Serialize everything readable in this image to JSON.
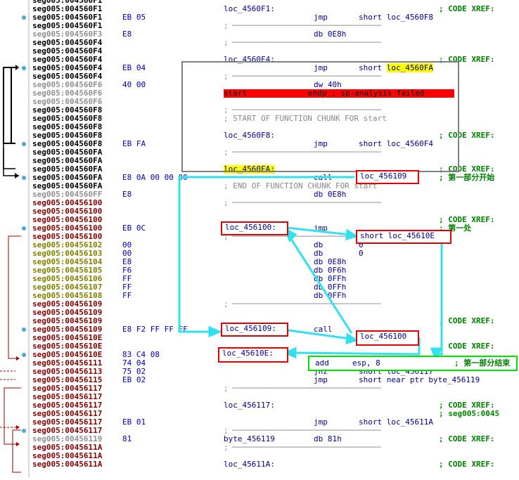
{
  "rows": [
    {
      "addr": "seg005:004560F1",
      "ac": "a-black",
      "bytes": "",
      "label": "",
      "mn": "",
      "op": "",
      "cm": ""
    },
    {
      "addr": "seg005:004560F1",
      "ac": "a-black",
      "bytes": "",
      "label": "loc_4560F1:",
      "mn": "",
      "op": "",
      "cm": "; CODE XREF:"
    },
    {
      "addr": "seg005:004560F1",
      "ac": "a-black",
      "bytes": "EB 05",
      "label": "",
      "mn": "jmp",
      "op": "short loc_4560F8",
      "cm": ""
    },
    {
      "addr": "seg005:004560F1",
      "ac": "a-black",
      "bytes": "",
      "label": ";",
      "mn": "",
      "op": "",
      "cm": "",
      "sep": true
    },
    {
      "addr": "seg005:004560F3",
      "ac": "a-gray",
      "bytes": "E8",
      "label": "",
      "mn": "db 0E8h",
      "op": "",
      "cm": ""
    },
    {
      "addr": "seg005:004560F4",
      "ac": "a-black",
      "bytes": "",
      "label": ";",
      "mn": "",
      "op": "",
      "cm": "",
      "sep": true
    },
    {
      "addr": "seg005:004560F4",
      "ac": "a-black",
      "bytes": "",
      "label": "",
      "mn": "",
      "op": "",
      "cm": ""
    },
    {
      "addr": "seg005:004560F4",
      "ac": "a-black",
      "bytes": "",
      "label": "loc_4560F4:",
      "mn": "",
      "op": "",
      "cm": "; CODE XREF:"
    },
    {
      "addr": "seg005:004560F4",
      "ac": "a-black",
      "bytes": "EB 04",
      "label": "",
      "mn": "jmp",
      "op": "short loc_4560FA",
      "cm": "",
      "ophl": "yellow"
    },
    {
      "addr": "seg005:004560F4",
      "ac": "a-black",
      "bytes": "",
      "label": ";",
      "mn": "",
      "op": "",
      "cm": "",
      "sep": true
    },
    {
      "addr": "seg005:004560F6",
      "ac": "a-gray",
      "bytes": "40 00",
      "label": "",
      "mn": "dw 40h",
      "op": "",
      "cm": ""
    },
    {
      "addr": "seg005:004560F6",
      "ac": "a-gray",
      "bytes": "",
      "label": "start",
      "mn": "endp ; sp-analysis failed",
      "op": "",
      "cm": "",
      "rowhl": "red"
    },
    {
      "addr": "seg005:004560F6",
      "ac": "a-gray",
      "bytes": "",
      "label": "",
      "mn": "",
      "op": "",
      "cm": ""
    },
    {
      "addr": "seg005:004560F8",
      "ac": "a-black",
      "bytes": "",
      "label": ";",
      "mn": "",
      "op": "",
      "cm": "",
      "sep": true
    },
    {
      "addr": "seg005:004560F8",
      "ac": "a-black",
      "bytes": "",
      "label": "; START OF FUNCTION CHUNK FOR start",
      "mn": "",
      "op": "",
      "cm": "",
      "gray": true
    },
    {
      "addr": "seg005:004560F8",
      "ac": "a-black",
      "bytes": "",
      "label": "",
      "mn": "",
      "op": "",
      "cm": ""
    },
    {
      "addr": "seg005:004560F8",
      "ac": "a-black",
      "bytes": "",
      "label": "loc_4560F8:",
      "mn": "",
      "op": "",
      "cm": "; CODE XREF:"
    },
    {
      "addr": "seg005:004560F8",
      "ac": "a-black",
      "bytes": "EB FA",
      "label": "",
      "mn": "jmp",
      "op": "short loc_4560F4",
      "cm": ""
    },
    {
      "addr": "seg005:004560FA",
      "ac": "a-black",
      "bytes": "",
      "label": ";",
      "mn": "",
      "op": "",
      "cm": "",
      "sep": true
    },
    {
      "addr": "seg005:004560FA",
      "ac": "a-black",
      "bytes": "",
      "label": "",
      "mn": "",
      "op": "",
      "cm": ""
    },
    {
      "addr": "seg005:004560FA",
      "ac": "a-black",
      "bytes": "",
      "label": "loc_4560FA:",
      "mn": "",
      "op": "",
      "cm": "; CODE XREF:",
      "lblhl": "yellow"
    },
    {
      "addr": "seg005:004560FA",
      "ac": "a-black",
      "bytes": "E8 0A 00 00 00",
      "label": "",
      "mn": "call",
      "op": "",
      "cm": "; 第一部分开始"
    },
    {
      "addr": "seg005:004560FA",
      "ac": "a-black",
      "bytes": "",
      "label": "; END OF FUNCTION CHUNK FOR start",
      "mn": "",
      "op": "",
      "cm": "",
      "gray": true
    },
    {
      "addr": "seg005:004560FF",
      "ac": "a-gray",
      "bytes": "E8",
      "label": "",
      "mn": "db 0E8h",
      "op": "",
      "cm": ""
    },
    {
      "addr": "seg005:00456100",
      "ac": "a-red",
      "bytes": "",
      "label": ";",
      "mn": "",
      "op": "",
      "cm": "",
      "sep": true
    },
    {
      "addr": "seg005:00456100",
      "ac": "a-red",
      "bytes": "",
      "label": "",
      "mn": "",
      "op": "",
      "cm": ""
    },
    {
      "addr": "seg005:00456100",
      "ac": "a-red",
      "bytes": "",
      "label": "",
      "mn": "",
      "op": "",
      "cm": "; CODE XREF:"
    },
    {
      "addr": "seg005:00456100",
      "ac": "a-red",
      "bytes": "EB 0C",
      "label": "",
      "mn": "jmp",
      "op": "",
      "cm": "; 第一处"
    },
    {
      "addr": "seg005:00456100",
      "ac": "a-red",
      "bytes": "",
      "label": ";",
      "mn": "",
      "op": "",
      "cm": "",
      "sep": true
    },
    {
      "addr": "seg005:00456102",
      "ac": "a-olive",
      "bytes": "00",
      "label": "",
      "mn": "db",
      "op": "0",
      "cm": ""
    },
    {
      "addr": "seg005:00456103",
      "ac": "a-olive",
      "bytes": "00",
      "label": "",
      "mn": "db",
      "op": "0",
      "cm": ""
    },
    {
      "addr": "seg005:00456104",
      "ac": "a-olive",
      "bytes": "E8",
      "label": "",
      "mn": "db 0E8h",
      "op": "",
      "cm": ""
    },
    {
      "addr": "seg005:00456105",
      "ac": "a-olive",
      "bytes": "F6",
      "label": "",
      "mn": "db 0F6h",
      "op": "",
      "cm": ""
    },
    {
      "addr": "seg005:00456106",
      "ac": "a-olive",
      "bytes": "FF",
      "label": "",
      "mn": "db 0FFh",
      "op": "",
      "cm": ""
    },
    {
      "addr": "seg005:00456107",
      "ac": "a-olive",
      "bytes": "FF",
      "label": "",
      "mn": "db 0FFh",
      "op": "",
      "cm": ""
    },
    {
      "addr": "seg005:00456108",
      "ac": "a-olive",
      "bytes": "FF",
      "label": "",
      "mn": "db 0FFh",
      "op": "",
      "cm": ""
    },
    {
      "addr": "seg005:00456109",
      "ac": "a-red",
      "bytes": "",
      "label": ";",
      "mn": "",
      "op": "",
      "cm": "",
      "sep": true
    },
    {
      "addr": "seg005:00456109",
      "ac": "a-red",
      "bytes": "",
      "label": "",
      "mn": "",
      "op": "",
      "cm": ""
    },
    {
      "addr": "seg005:00456109",
      "ac": "a-red",
      "bytes": "",
      "label": "",
      "mn": "",
      "op": "",
      "cm": "; CODE XREF:"
    },
    {
      "addr": "seg005:00456109",
      "ac": "a-red",
      "bytes": "E8 F2 FF FF FF",
      "label": "",
      "mn": "call",
      "op": "",
      "cm": ""
    },
    {
      "addr": "seg005:0045610E",
      "ac": "a-red",
      "bytes": "",
      "label": "",
      "mn": "",
      "op": "",
      "cm": ""
    },
    {
      "addr": "seg005:0045610E",
      "ac": "a-red",
      "bytes": "",
      "label": "",
      "mn": "",
      "op": "",
      "cm": "; CODE XREF:"
    },
    {
      "addr": "seg005:0045610E",
      "ac": "a-red",
      "bytes": "83 C4 08",
      "label": "",
      "mn": "",
      "op": "",
      "cm": ""
    },
    {
      "addr": "seg005:00456111",
      "ac": "a-red",
      "bytes": "74 04",
      "label": "",
      "mn": "jz",
      "op": "short loc_456117",
      "cm": ""
    },
    {
      "addr": "seg005:00456113",
      "ac": "a-red",
      "bytes": "75 02",
      "label": "",
      "mn": "jnz",
      "op": "short loc_456117",
      "cm": ""
    },
    {
      "addr": "seg005:00456115",
      "ac": "a-red",
      "bytes": "EB 02",
      "label": "",
      "mn": "jmp",
      "op": "short near ptr byte_456119",
      "cm": ""
    },
    {
      "addr": "seg005:00456117",
      "ac": "a-red",
      "bytes": "",
      "label": ";",
      "mn": "",
      "op": "",
      "cm": "",
      "sep": true
    },
    {
      "addr": "seg005:00456117",
      "ac": "a-red",
      "bytes": "",
      "label": "",
      "mn": "",
      "op": "",
      "cm": ""
    },
    {
      "addr": "seg005:00456117",
      "ac": "a-red",
      "bytes": "",
      "label": "loc_456117:",
      "mn": "",
      "op": "",
      "cm": "; CODE XREF:"
    },
    {
      "addr": "seg005:00456117",
      "ac": "a-red",
      "bytes": "",
      "label": "",
      "mn": "",
      "op": "",
      "cm": "; seg005:0045"
    },
    {
      "addr": "seg005:00456117",
      "ac": "a-red",
      "bytes": "EB 01",
      "label": "",
      "mn": "jmp",
      "op": "short loc_45611A",
      "cm": ""
    },
    {
      "addr": "seg005:00456117",
      "ac": "a-red",
      "bytes": "",
      "label": ";",
      "mn": "",
      "op": "",
      "cm": "",
      "sep": true
    },
    {
      "addr": "seg005:00456119",
      "ac": "a-gray",
      "bytes": "81",
      "label": "byte_456119",
      "mn": "db 81h",
      "op": "",
      "cm": "; CODE XREF:"
    },
    {
      "addr": "seg005:0045611A",
      "ac": "a-red",
      "bytes": "",
      "label": ";",
      "mn": "",
      "op": "",
      "cm": "",
      "sep": true
    },
    {
      "addr": "seg005:0045611A",
      "ac": "a-red",
      "bytes": "",
      "label": "",
      "mn": "",
      "op": "",
      "cm": ""
    },
    {
      "addr": "seg005:0045611A",
      "ac": "a-red",
      "bytes": "",
      "label": "loc_45611A:",
      "mn": "",
      "op": "",
      "cm": "; CODE XREF:"
    }
  ],
  "annotations": {
    "loc_456109_top": "loc_456109",
    "loc_456100_label": "loc_456100:",
    "short_loc_45610E": "short loc_45610E",
    "loc_456109_label": "loc_456109:",
    "loc_456100_target": "loc_456100",
    "loc_45610E_label": "loc_45610E:",
    "add_esp": "add     esp, 8",
    "part1_end": "; 第一部分结束"
  },
  "colors": {
    "arrow": "#33e0f0",
    "red_box": "#e00000",
    "green_box": "#00e000",
    "gray_box": "#808080",
    "highlight_yellow": "#ffff00",
    "highlight_red": "#ff0000"
  }
}
